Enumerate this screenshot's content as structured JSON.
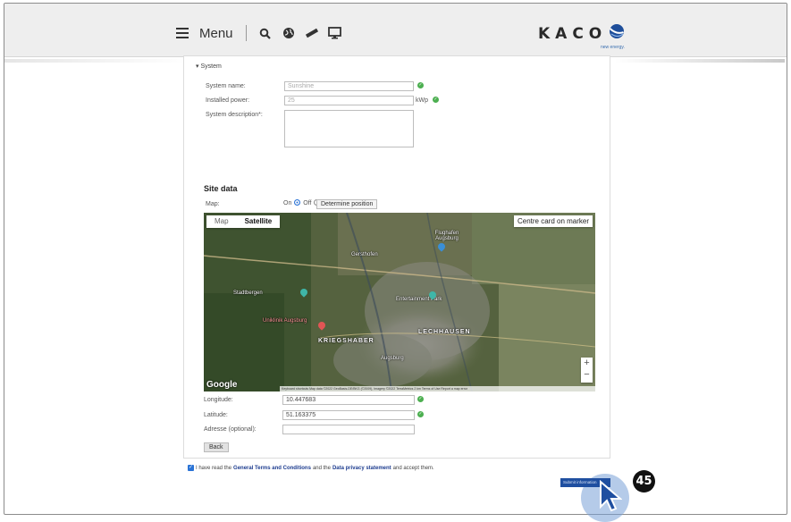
{
  "header": {
    "menu_label": "Menu",
    "logo_text": "KACO",
    "logo_tagline": "new energy."
  },
  "system": {
    "section_title": "System",
    "name_label": "System name:",
    "name_value": "Sunshine",
    "power_label": "Installed power:",
    "power_value": "25",
    "power_unit": "kWp",
    "description_label": "System description*:"
  },
  "site": {
    "title": "Site data",
    "map_label": "Map:",
    "on_label": "On",
    "off_label": "Off",
    "determine_label": "Determine position",
    "longitude_label": "Longitude:",
    "longitude_value": "10.447683",
    "latitude_label": "Latitude:",
    "latitude_value": "51.163375",
    "address_label": "Adresse (optional):",
    "address_value": ""
  },
  "map": {
    "tab_map": "Map",
    "tab_satellite": "Satellite",
    "centre_label": "Centre card on marker",
    "zoom_in": "+",
    "zoom_out": "−",
    "google": "Google",
    "attribution": "Keyboard shortcuts   Map data ©2022 GeoBasis-DE/BKG (©2009), Imagery ©2022 TerraMetrics   2 km   Terms of Use   Report a map error",
    "places": {
      "p1": "Gersthofen",
      "p2": "Flughafen Augsburg",
      "p3": "Stadtbergen",
      "p4": "Uniklinik Augsburg",
      "p5": "KRIEGSHABER",
      "p6": "LECHHAUSEN",
      "p7": "Augsburg",
      "p8": "Entertainment Park"
    }
  },
  "actions": {
    "back_label": "Back",
    "submit_label": "Submit information",
    "terms_prefix": "I have read the",
    "terms_link1": "General Terms and Conditions",
    "terms_mid": "and the",
    "terms_link2": "Data privacy statement",
    "terms_suffix": "and accept them."
  },
  "step_badge": "45",
  "colors": {
    "accent": "#2a73d6",
    "success": "#4caf50",
    "submit_bg": "#1f4fa0",
    "header_bg": "#eeeeee"
  }
}
